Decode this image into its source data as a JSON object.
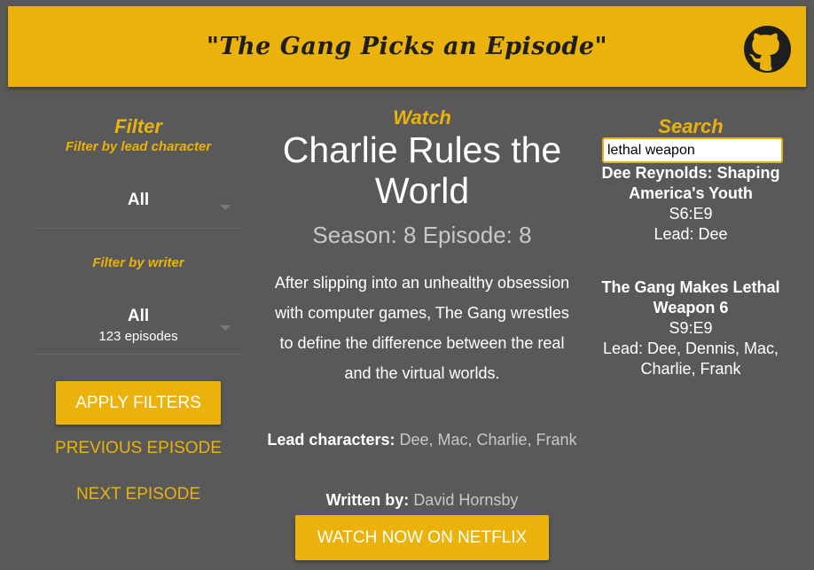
{
  "header": {
    "title": "\"The Gang Picks an Episode\"",
    "icon": "github-icon"
  },
  "filter": {
    "heading": "Filter",
    "lead_label": "Filter by lead character",
    "lead_value": "All",
    "writer_label": "Filter by writer",
    "writer_value": "All",
    "writer_count": "123 episodes",
    "apply_label": "APPLY FILTERS",
    "previous_label": "PREVIOUS EPISODE",
    "next_label": "NEXT EPISODE"
  },
  "watch": {
    "heading": "Watch",
    "title": "Charlie Rules the World",
    "season_line": "Season: 8 Episode: 8",
    "description": "After slipping into an unhealthy obsession with computer games, The Gang wrestles to define the difference between the real and the virtual worlds.",
    "lead_label": "Lead characters:",
    "lead_value": "Dee, Mac, Charlie, Frank",
    "writer_label": "Written by:",
    "writer_value": "David Hornsby",
    "netflix_label": "WATCH NOW ON NETFLIX"
  },
  "search": {
    "heading": "Search",
    "query": "lethal weapon",
    "results": [
      {
        "title": "Dee Reynolds: Shaping America's Youth",
        "episode": "S6:E9",
        "lead": "Lead: Dee"
      },
      {
        "title": "The Gang Makes Lethal Weapon 6",
        "episode": "S9:E9",
        "lead": "Lead: Dee, Dennis, Mac, Charlie, Frank"
      }
    ]
  },
  "colors": {
    "accent": "#eab20a",
    "background": "#595959",
    "muted_text": "#c8c8c8"
  }
}
